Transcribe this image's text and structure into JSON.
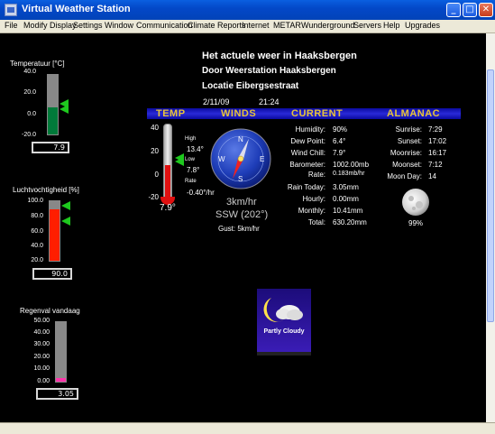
{
  "window": {
    "title": "Virtual Weather Station"
  },
  "menu": [
    "File",
    "Modify Display",
    "Settings",
    "Window",
    "Communication",
    "Climate Reports",
    "Internet",
    "METAR",
    "Wunderground",
    "Servers",
    "Help",
    "Upgrades"
  ],
  "header": {
    "line1": "Het actuele weer in Haaksbergen",
    "line2": "Door Weerstation Haaksbergen",
    "line3": "Locatie Eibergsestraat",
    "date": "2/11/09",
    "time": "21:24"
  },
  "sections": {
    "temp": "TEMP",
    "winds": "WINDS",
    "current": "CURRENT",
    "almanac": "ALMANAC"
  },
  "side_temp": {
    "label": "Temperatuur [°C]",
    "ticks": [
      "40.0",
      "20.0",
      "0.0",
      "-20.0"
    ],
    "value": "7.9",
    "fill_percent": 46
  },
  "side_hum": {
    "label": "Luchtvochtigheid [%]",
    "ticks": [
      "100.0",
      "80.0",
      "60.0",
      "40.0",
      "20.0"
    ],
    "value": "90.0",
    "fill_percent": 87
  },
  "side_rain": {
    "label": "Regenval vandaag",
    "ticks": [
      "50.00",
      "40.00",
      "30.00",
      "20.00",
      "10.00",
      "0.00"
    ],
    "value": "3.05",
    "fill_percent": 6
  },
  "temp_panel": {
    "ticks": [
      "40",
      "20",
      "0",
      "-20"
    ],
    "high_label": "High",
    "high": "13.4°",
    "low_label": "Low",
    "low": "7.8°",
    "rate_label": "Rate",
    "rate": "-0.40°/hr",
    "current": "7.9°",
    "fill_percent": 46
  },
  "wind": {
    "speed": "3km/hr",
    "dir": "SSW (202°)",
    "gust": "Gust: 5km/hr",
    "n": "N",
    "e": "E",
    "s": "S",
    "w": "W",
    "deg": 202
  },
  "current": [
    {
      "label": "Humidity:",
      "value": "90%"
    },
    {
      "label": "Dew Point:",
      "value": "6.4°"
    },
    {
      "label": "Wind Chill:",
      "value": "7.9°"
    },
    {
      "label": "Barometer:",
      "value": "1002.00mb"
    },
    {
      "label": "Rate:",
      "value": "0.183mb/hr"
    },
    {
      "label": "Rain Today:",
      "value": "3.05mm"
    },
    {
      "label": "Hourly:",
      "value": "0.00mm"
    },
    {
      "label": "Monthly:",
      "value": "10.41mm"
    },
    {
      "label": "Total:",
      "value": "630.20mm"
    }
  ],
  "almanac": [
    {
      "label": "Sunrise:",
      "value": "7:29"
    },
    {
      "label": "Sunset:",
      "value": "17:02"
    },
    {
      "label": "Moonrise:",
      "value": "16:17"
    },
    {
      "label": "Moonset:",
      "value": "7:12"
    },
    {
      "label": "Moon Day:",
      "value": "14"
    }
  ],
  "moon": {
    "percent": "99%"
  },
  "forecast": {
    "label": "Partly Cloudy"
  }
}
